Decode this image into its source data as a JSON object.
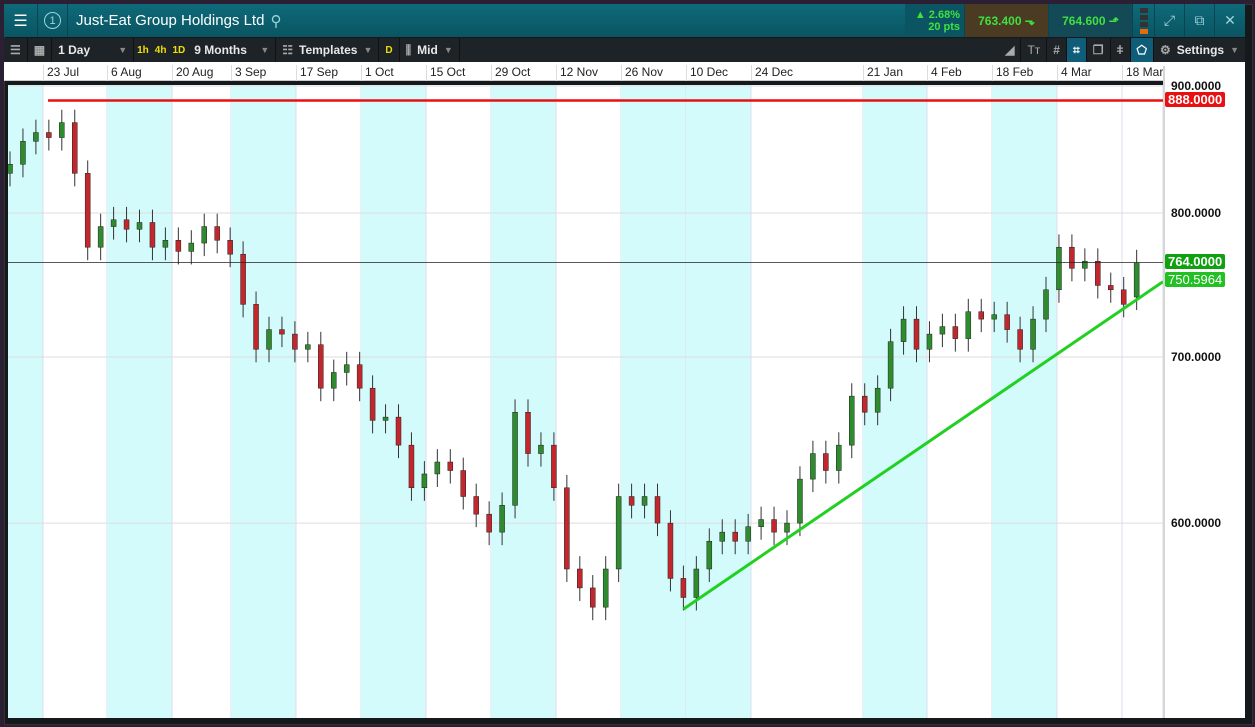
{
  "header": {
    "instrument": "Just-Eat Group Holdings Ltd",
    "tab_number": "1",
    "change_pct": "▲ 2.68%",
    "change_pts": "20 pts",
    "sell_price": "763.400",
    "buy_price": "764.600"
  },
  "toolbar": {
    "interval": "1 Day",
    "quick": [
      "1h",
      "4h",
      "1D"
    ],
    "range": "9 Months",
    "templates": "Templates",
    "d": "D",
    "price_type": "Mid",
    "settings": "Settings"
  },
  "dates": [
    "23 Jul",
    "6 Aug",
    "20 Aug",
    "3 Sep",
    "17 Sep",
    "1 Oct",
    "15 Oct",
    "29 Oct",
    "12 Nov",
    "26 Nov",
    "10 Dec",
    "24 Dec",
    "21 Jan",
    "4 Feb",
    "18 Feb",
    "4 Mar",
    "18 Mar"
  ],
  "axis": {
    "labels": [
      "900.0000",
      "800.0000",
      "700.0000",
      "600.0000"
    ],
    "values": [
      900,
      800,
      700,
      600
    ]
  },
  "colors": {
    "up": "#2e8b2e",
    "down": "#c1272d",
    "resistance": "#e81010",
    "trend": "#22d022",
    "band": "#d4fbfb"
  },
  "chart_data": {
    "type": "candlestick",
    "scale": "log",
    "ylim": [
      500,
      910
    ],
    "open": [
      830,
      837,
      855,
      862,
      858,
      870,
      830,
      775,
      790,
      795,
      788,
      793,
      775,
      780,
      772,
      778,
      790,
      780,
      770,
      735,
      705,
      718,
      715,
      705,
      708,
      680,
      690,
      695,
      680,
      660,
      662,
      645,
      620,
      628,
      635,
      630,
      615,
      605,
      595,
      610,
      665,
      640,
      645,
      620,
      575,
      565,
      555,
      575,
      615,
      610,
      615,
      600,
      570,
      560,
      575,
      590,
      595,
      590,
      598,
      602,
      595,
      600,
      625,
      640,
      630,
      645,
      675,
      665,
      680,
      710,
      725,
      705,
      715,
      720,
      712,
      730,
      725,
      728,
      718,
      705,
      725,
      745,
      775,
      760,
      765,
      748,
      745,
      740
    ],
    "close": [
      837,
      855,
      862,
      858,
      870,
      830,
      775,
      790,
      795,
      788,
      793,
      775,
      780,
      772,
      778,
      790,
      780,
      770,
      735,
      705,
      718,
      715,
      705,
      708,
      680,
      690,
      695,
      680,
      660,
      662,
      645,
      620,
      628,
      635,
      630,
      615,
      605,
      595,
      610,
      665,
      640,
      645,
      620,
      575,
      565,
      555,
      575,
      615,
      610,
      615,
      600,
      570,
      560,
      575,
      590,
      595,
      590,
      598,
      602,
      595,
      600,
      625,
      640,
      630,
      645,
      675,
      665,
      680,
      710,
      725,
      705,
      715,
      720,
      712,
      730,
      725,
      728,
      718,
      705,
      725,
      745,
      775,
      760,
      765,
      748,
      745,
      735,
      764
    ],
    "resistance": {
      "value": 888,
      "label": "888.0000"
    },
    "current": {
      "value": 764,
      "label": "764.0000"
    },
    "trendline": {
      "start_bar": 52,
      "start_price": 554,
      "end_price": 750.5964,
      "label": "750.5964"
    }
  }
}
